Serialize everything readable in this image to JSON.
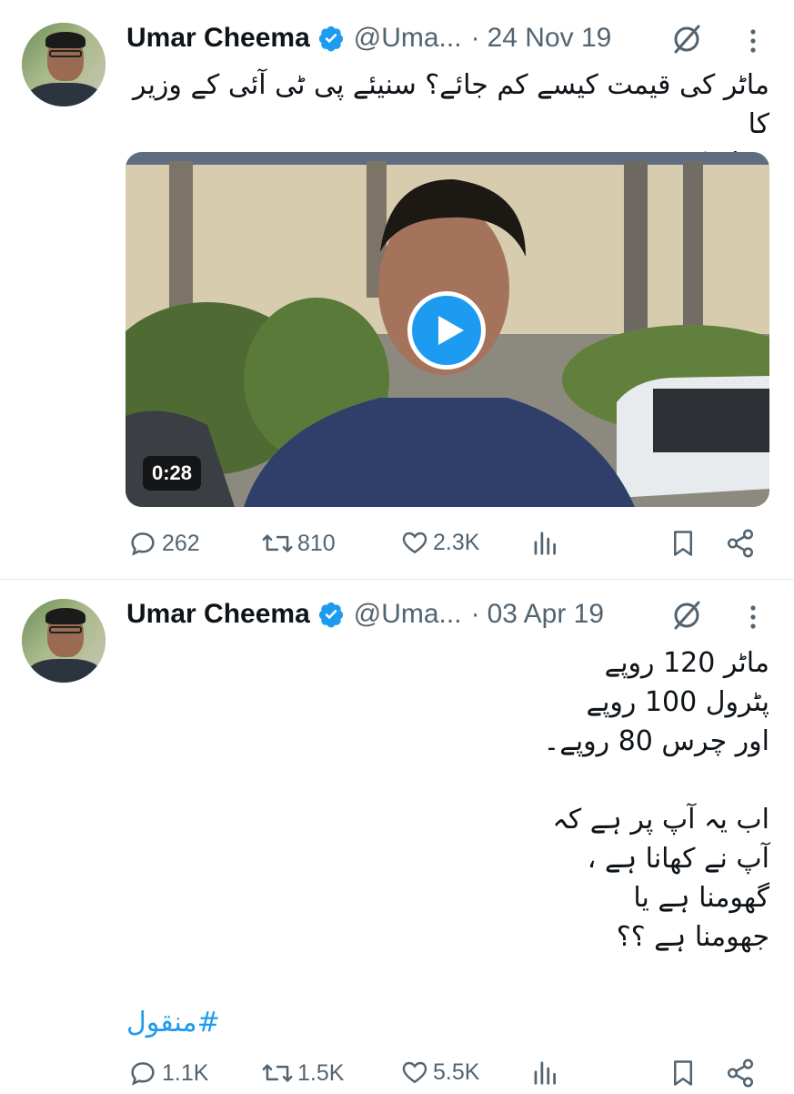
{
  "colors": {
    "accent": "#1d9bf0",
    "muted": "#536471",
    "text": "#0f1419"
  },
  "tweets": [
    {
      "name": "Umar Cheema",
      "handle": "@Uma...",
      "separator": "·",
      "date": "24 Nov 19",
      "text_lines": [
        "ماٹر کی قیمت کیسے کم جائے؟ سنیئے پی ٹی آئی کے وزیر کا",
        "عوام کو مشورہ"
      ],
      "video": {
        "duration": "0:28"
      },
      "stats": {
        "replies": "262",
        "reposts": "810",
        "likes": "2.3K"
      }
    },
    {
      "name": "Umar Cheema",
      "handle": "@Uma...",
      "separator": "·",
      "date": "03 Apr 19",
      "text_lines": [
        "ماٹر 120 روپے",
        "پٹرول 100 روپے",
        "اور چرس 80 روپے۔",
        "",
        "اب یہ آپ پر ہے کہ",
        "آپ نے کھانا ہے ،",
        "گھومنا ہے یا",
        "جھومنا ہے ؟؟"
      ],
      "hashtag": "#منقول",
      "stats": {
        "replies": "1.1K",
        "reposts": "1.5K",
        "likes": "5.5K"
      }
    }
  ]
}
